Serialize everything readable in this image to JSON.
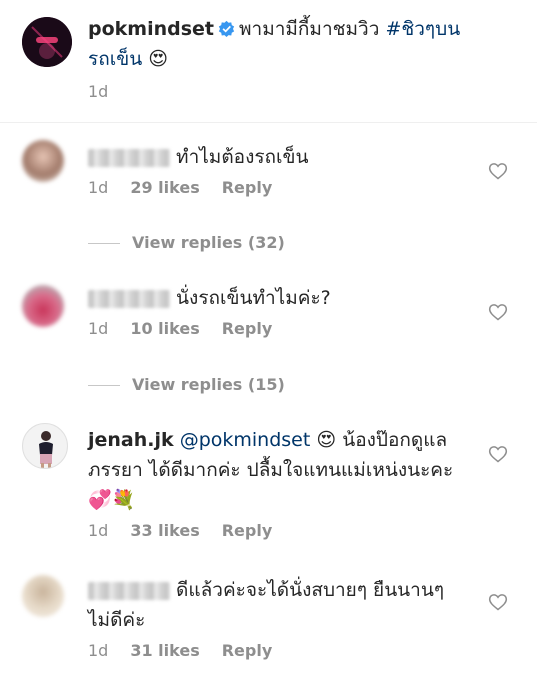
{
  "post": {
    "username": "pokmindset",
    "caption_line1": "พามามีกี้มาชมวิว",
    "hashtag": "#ชิวๆบน",
    "caption_line2": "รถเข็น",
    "emoji": "😍",
    "time": "1d"
  },
  "comments": [
    {
      "username_redacted": true,
      "text": "ทำไมต้องรถเข็น",
      "time": "1d",
      "likes": "29 likes",
      "reply": "Reply",
      "view_replies": "View replies (32)"
    },
    {
      "username_redacted": true,
      "text": "นั่งรถเข็นทำไมค่ะ?",
      "time": "1d",
      "likes": "10 likes",
      "reply": "Reply",
      "view_replies": "View replies (15)"
    },
    {
      "username": "jenah.jk",
      "mention": "@pokmindset",
      "emoji": "😍",
      "text_part1": "น้องป๊อกดูแล",
      "text_line2": "ภรรยา ได้ดีมากค่ะ ปลื้มใจแทนแม่เหน่งนะคะ",
      "emoji_line3": "💞💐",
      "time": "1d",
      "likes": "33 likes",
      "reply": "Reply"
    },
    {
      "username_redacted": true,
      "text_line1": "ดีแล้วค่ะจะได้นั่งสบายๆ ยืนนานๆ",
      "text_line2": "ไม่ดีค่ะ",
      "time": "1d",
      "likes": "31 likes",
      "reply": "Reply"
    }
  ],
  "icons": {
    "heart": "heart-outline-icon",
    "verified": "verified-badge-icon"
  },
  "colors": {
    "text": "#262626",
    "meta": "#8e8e8e",
    "link": "#003569",
    "verified": "#3897f0"
  }
}
